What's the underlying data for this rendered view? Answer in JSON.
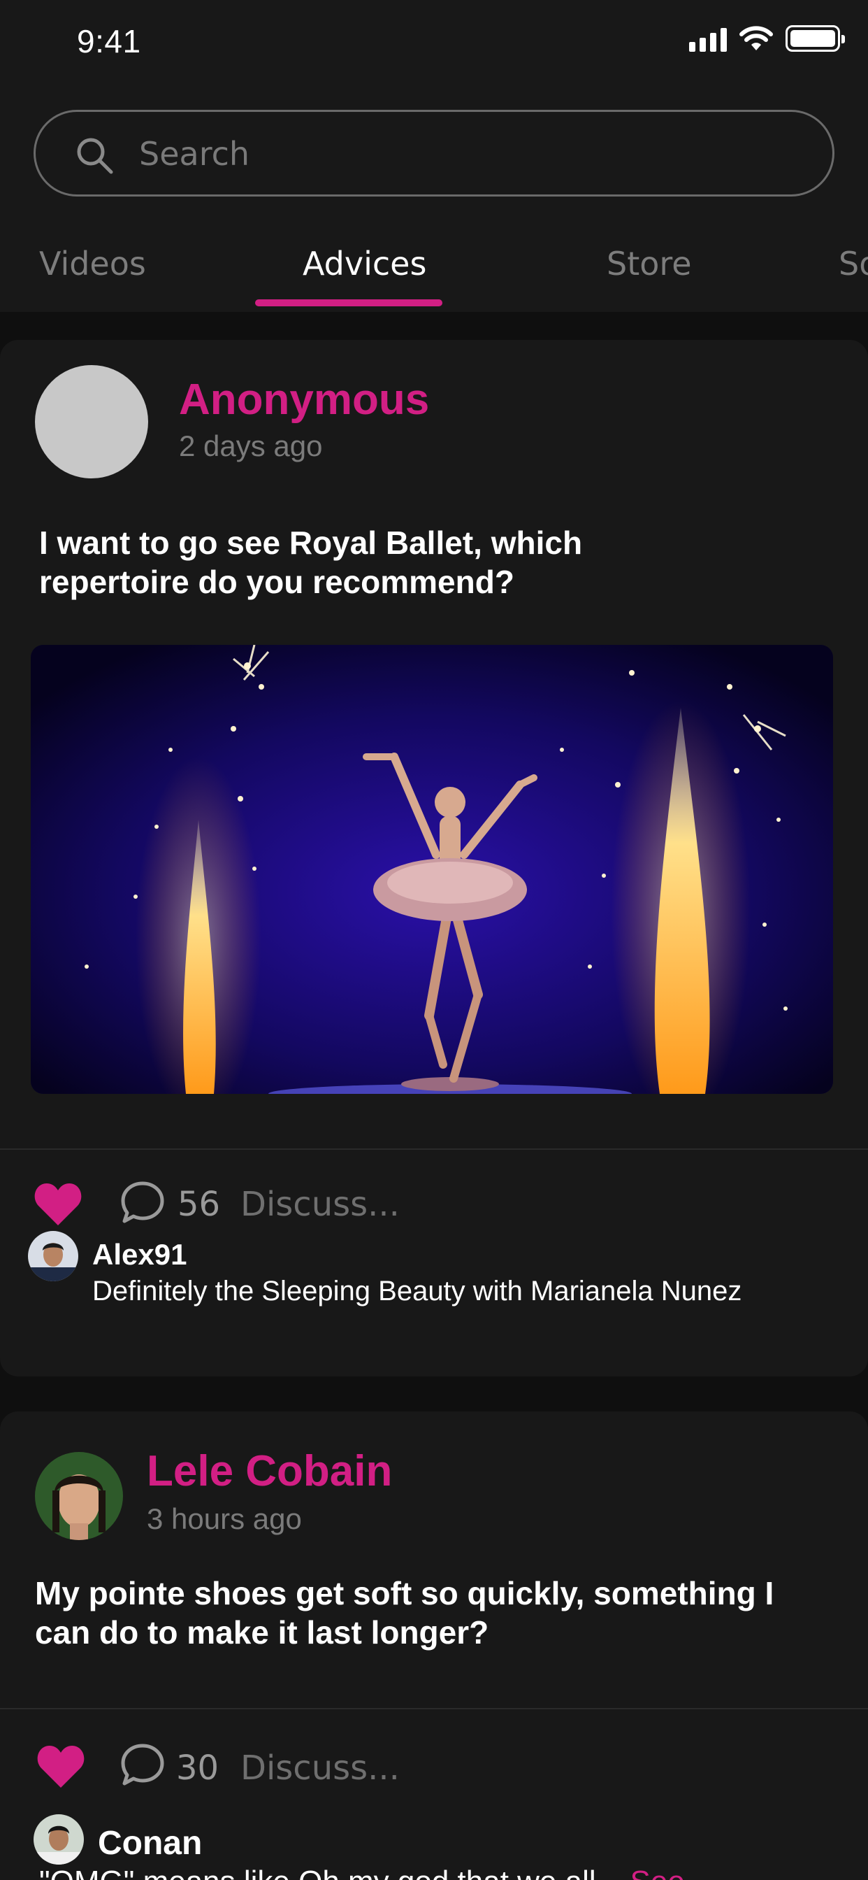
{
  "status_bar": {
    "time": "9:41"
  },
  "search": {
    "placeholder": "Search"
  },
  "tabs": [
    {
      "label": "Videos",
      "active": false
    },
    {
      "label": "Advices",
      "active": true
    },
    {
      "label": "Store",
      "active": false
    },
    {
      "label": "So",
      "active": false
    }
  ],
  "posts": [
    {
      "author": "Anonymous",
      "time_ago": "2 days ago",
      "question": "I want to go see Royal Ballet, which repertoire do you recommend?",
      "has_image": true,
      "comment_count": "56",
      "discuss_placeholder": "Discuss...",
      "top_comment": {
        "user": "Alex91",
        "text": "Definitely the Sleeping Beauty with Marianela Nunez"
      }
    },
    {
      "author": "Lele Cobain",
      "time_ago": "3 hours ago",
      "question": "My pointe shoes get soft so quickly, something I can do to make it last longer?",
      "has_image": false,
      "comment_count": "30",
      "discuss_placeholder": "Discuss...",
      "top_comment": {
        "user": "Conan",
        "text": "\"OMG\" means like Oh my god that we all... ",
        "more": "See"
      }
    }
  ],
  "colors": {
    "accent": "#d21f84",
    "background": "#0f0f0f",
    "card": "#181818",
    "muted": "#7b7b7b"
  },
  "icons": [
    "search-icon",
    "heart-icon",
    "comment-icon",
    "signal-icon",
    "wifi-icon",
    "battery-icon"
  ]
}
